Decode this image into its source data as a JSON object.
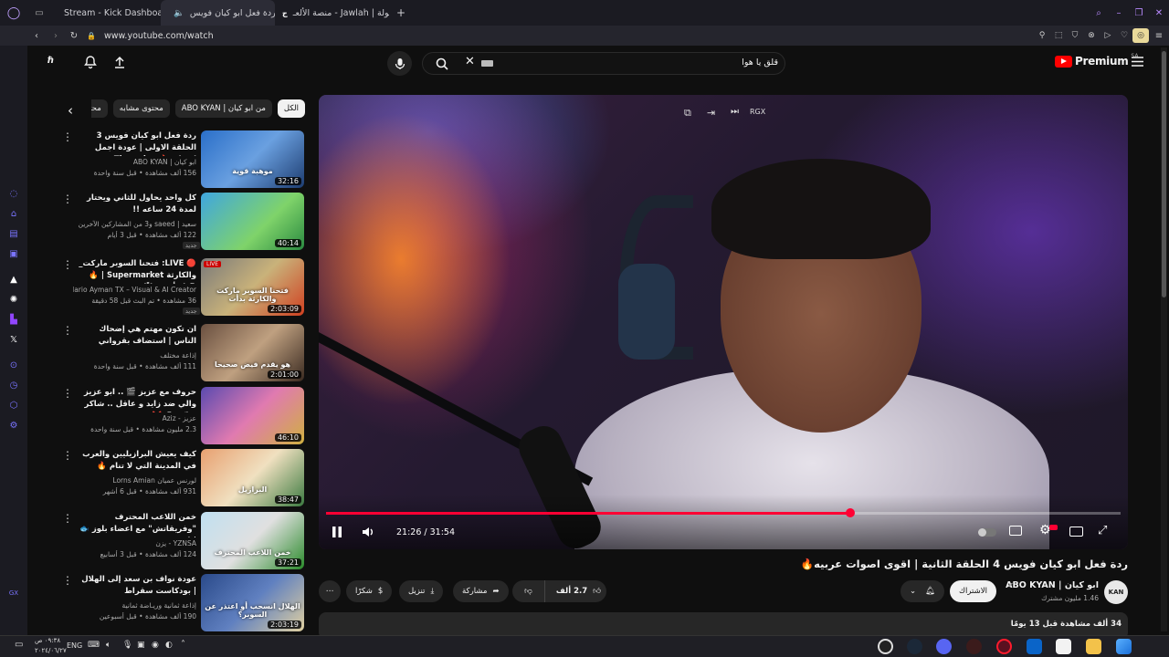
{
  "browser": {
    "tabs": [
      {
        "label": "Stream - Kick Dashboard"
      },
      {
        "label": "ردة فعل ابو كيان فويس"
      },
      {
        "label": "جولة | Jawlah - منصة الألعـ"
      }
    ],
    "url": "www.youtube.com/watch"
  },
  "youtube": {
    "logo": "Premium",
    "region": "SA",
    "search_value": "قلق يا هوا"
  },
  "chips": [
    "الكل",
    "من ابو كيان | ABO KYAN",
    "محتوى مشابه",
    "محتو"
  ],
  "recs": [
    {
      "title": "ردة فعل ابو كيان فويس 3 الحلقة الاولى | عودة اجمل اصوات 🔥 The voice",
      "channel": "ابو كيان | ABO KYAN",
      "meta": "156 ألف مشاهدة • قبل سنة واحدة",
      "duration": "32:16",
      "badge": "",
      "thumb_text": "موهبة قوية"
    },
    {
      "title": "كل واحد يحاول للثاني ويحتار لمدة 24 ساعه !!",
      "channel": "سعيد | saeed و3 من المشاركين الآخرين",
      "meta": "122 ألف مشاهدة • قبل 3 أيام",
      "duration": "40:14",
      "badge": "جديد",
      "thumb_text": ""
    },
    {
      "title": "🔴 LIVE: فتحنا السوبر ماركت_ والكارثة Supermarket | 🔥 😱 ابدأت فعلاً!",
      "channel": "Mario Ayman TX – Visual & AI Creator",
      "meta": "36 مشاهدة • تم البث قبل 58 دقيقة",
      "duration": "2:03:09",
      "badge": "جديد",
      "thumb_text": "فتحنا السوبر ماركت والكارثة بدأت",
      "live": "LIVE"
    },
    {
      "title": "ان تكون مهتم هي إضحاك الناس | استضاف بقرواني",
      "channel": "إذاعة مختلف",
      "meta": "111 ألف مشاهدة • قبل سنة واحدة",
      "duration": "2:01:00",
      "badge": "",
      "thumb_text": "هو يقدم فيض صحيحا"
    },
    {
      "title": "حروف مع عزيز 🎬 .. ابو عزيز والي ضد زايد و عاقل .. شاكر شاكر 😂 ❌",
      "channel": "عزيز - Aziz",
      "meta": "2.3 مليون مشاهدة • قبل سنة واحدة",
      "duration": "46:10",
      "badge": "",
      "thumb_text": ""
    },
    {
      "title": "كيف يعيش البرازيليين والعرب في المدينة التي لا تنام 🔥",
      "channel": "لورنس عميان Lorns Amian",
      "meta": "931 ألف مشاهدة • قبل 6 أشهر",
      "duration": "38:47",
      "badge": "",
      "thumb_text": "البرازيل"
    },
    {
      "title": "خمن اللاعب المحترف \"وفريقاتش\" مع اعضاء بلوز 🐟 | !",
      "channel": "YZNSA - يزن",
      "meta": "124 ألف مشاهدة • قبل 3 أسابيع",
      "duration": "37:21",
      "badge": "",
      "thumb_text": "خمن اللاعب المحترف"
    },
    {
      "title": "عودة نواف بن سعد إلى الهلال | بودكاست سقراط",
      "channel": "إذاعة ثمانية وريـاضة ثمانية",
      "meta": "190 ألف مشاهدة • قبل أسبوعين",
      "duration": "2:03:19",
      "badge": "",
      "thumb_text": "الهلال انسحب أو اعتذر عن السوبر؟"
    }
  ],
  "player": {
    "time": "21:26 / 31:54",
    "progress": 0.66,
    "top_label": "RGX"
  },
  "video": {
    "title": "ردة فعل ابو كيان فويس 4 الحلقة الثانية | اقوى اصوات عربيه🔥",
    "channel": "ابو كيان | ABO KYAN",
    "subs": "1.46 مليون مشترك",
    "join": "الاشتراك",
    "avatar_text": "KAN",
    "likes": "2.7 ألف",
    "share": "مشاركة",
    "download": "تنزيل",
    "thanks": "شكرًا",
    "views": "34 ألف مشاهدة قبل 13 يومًا"
  },
  "taskbar": {
    "lang": "ENG",
    "time": "٠٩:٣٨ ص",
    "date": "٢٠٢٤/٠٦/٢٧"
  }
}
